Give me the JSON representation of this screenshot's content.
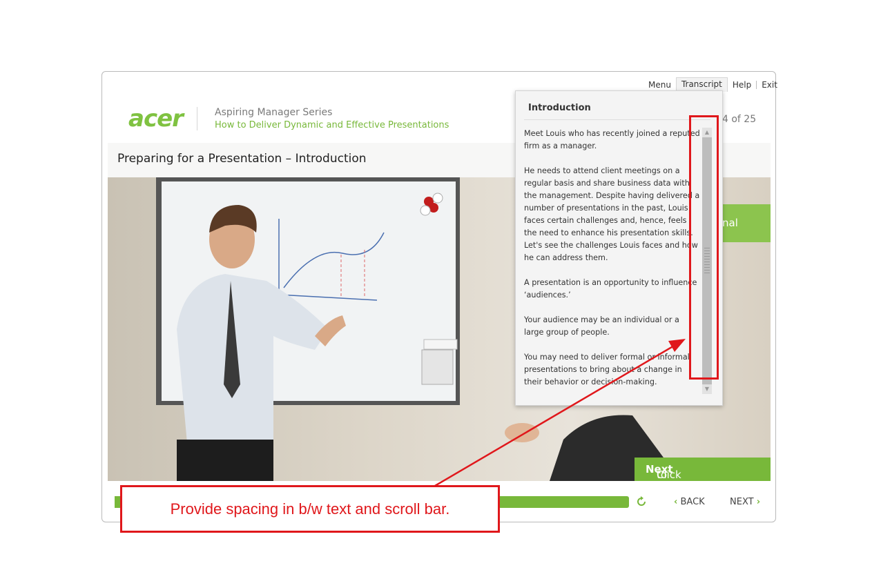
{
  "header": {
    "logo": "acer",
    "series_title": "Aspiring Manager Series",
    "course_title": "How to Deliver Dynamic and Effective Presentations"
  },
  "topnav": {
    "menu": "Menu",
    "transcript": "Transcript",
    "help": "Help",
    "exit": "Exit"
  },
  "page_counter": "4 of 25",
  "slide_title": "Preparing for a Presentation – Introduction",
  "green_tab_text": "nal",
  "transcript": {
    "title": "Introduction",
    "paragraphs": [
      "Meet Louis who has recently joined a reputed firm as a manager.",
      "He needs to attend client meetings on a regular basis and share business data with the management. Despite having delivered a number of presentations in the past, Louis faces certain challenges and, hence, feels the need to enhance his presentation skills. Let's see the challenges Louis faces and how he can address them.",
      "A presentation is an opportunity to influence ‘audiences.’",
      "Your audience may be an individual or a large group of people.",
      "You may need to deliver formal or informal presentations to bring about a change in their behavior or decision-making."
    ]
  },
  "next_hint": {
    "prefix": "Click",
    "bold": "Next",
    "suffix": "to continue."
  },
  "footer": {
    "back": "BACK",
    "next": "NEXT"
  },
  "annotation": {
    "text": "Provide spacing in b/w text and scroll bar."
  },
  "colors": {
    "brand_green": "#78b83a",
    "annotation_red": "#e0171b"
  },
  "icons": [
    "refresh-icon",
    "chevron-left-icon",
    "chevron-right-icon",
    "scroll-up-icon",
    "scroll-down-icon"
  ]
}
